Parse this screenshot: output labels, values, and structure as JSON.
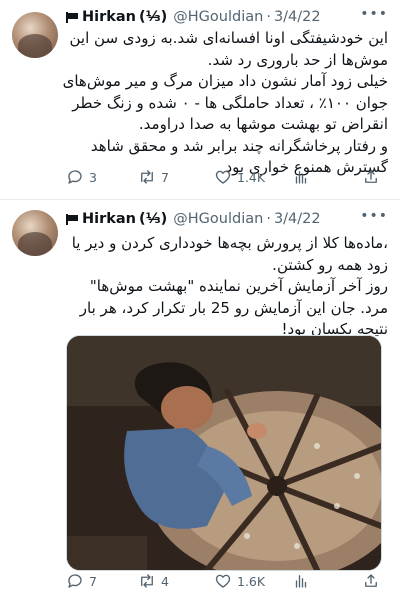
{
  "tweets": [
    {
      "author": {
        "display_name": "Hirkan",
        "emblem": "(⅓̶)",
        "handle": "@HGouldian",
        "date": "3/4/22"
      },
      "paragraphs": [
        "این خودشیفتگی اونا افسانه‌ای شد.به زودی سن این موش‌ها از حد باروری رد شد.",
        "خیلی زود آمار نشون داد میزان مرگ و میر موش‌های جوان ۱۰۰٪ ، تعداد حاملگی ها - ۰ شده و زنگ خطر انقراض تو بهشت موشها به صدا دراومد.",
        "و رفتار پرخاشگرانه چند برابر شد و محقق شاهد گسترش همنوع خواری بود"
      ],
      "stats": {
        "replies": "3",
        "retweets": "7",
        "likes": "1.4K"
      }
    },
    {
      "author": {
        "display_name": "Hirkan",
        "emblem": "(⅓̶)",
        "handle": "@HGouldian",
        "date": "3/4/22"
      },
      "paragraphs": [
        "،ماده‌ها کلا از پرورش بچه‌ها خودداری کردن و دیر یا زود همه رو کشتن.",
        "روز آخر آزمایش آخرین نماینده \"بهشت موش‌ها\" مرد. جان این آزمایش رو 25 بار تکرار کرد، هر بار نتیجه یکسان بود!"
      ],
      "stats": {
        "replies": "7",
        "retweets": "4",
        "likes": "1.6K"
      }
    }
  ],
  "icons": [
    "flag-icon",
    "more-icon",
    "reply-icon",
    "retweet-icon",
    "like-icon",
    "views-icon",
    "share-icon"
  ],
  "colors": {
    "text": "#0f1419",
    "secondary": "#536471",
    "divider": "#e6ecf0"
  }
}
